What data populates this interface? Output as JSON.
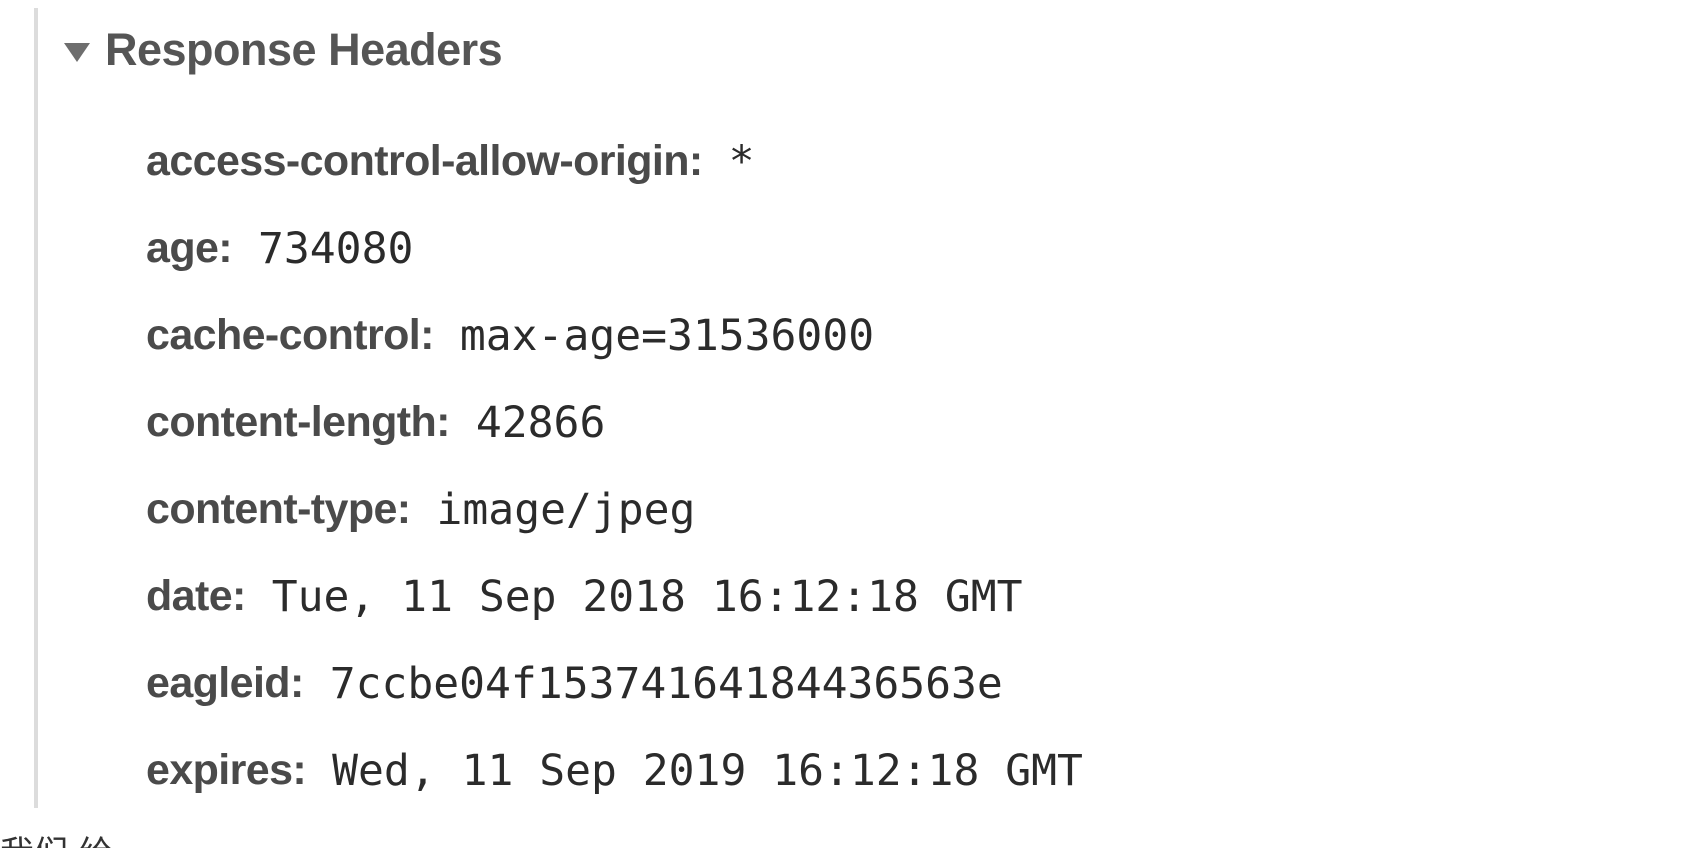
{
  "section": {
    "title": "Response Headers",
    "expanded": true,
    "toggle_icon": "triangle-down-icon"
  },
  "headers": [
    {
      "name": "access-control-allow-origin:",
      "value": "*"
    },
    {
      "name": "age:",
      "value": "734080"
    },
    {
      "name": "cache-control:",
      "value": "max-age=31536000"
    },
    {
      "name": "content-length:",
      "value": "42866"
    },
    {
      "name": "content-type:",
      "value": "image/jpeg"
    },
    {
      "name": "date:",
      "value": "Tue, 11 Sep 2018 16:12:18 GMT"
    },
    {
      "name": "eagleid:",
      "value": "7ccbe04f15374164184436563e"
    },
    {
      "name": "expires:",
      "value": "Wed, 11 Sep 2019 16:12:18 GMT"
    }
  ],
  "footer_text": "我们 给"
}
